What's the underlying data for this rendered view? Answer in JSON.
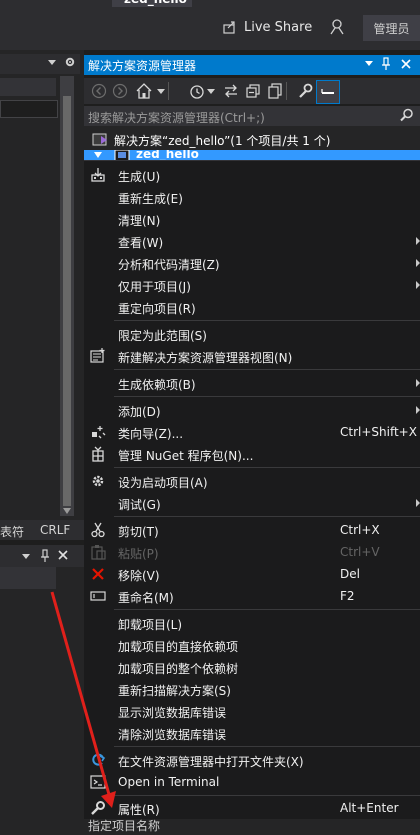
{
  "titlebar": {
    "tab_title": "zed_hello",
    "live_share": "Live Share",
    "admin": "管理员"
  },
  "left_panel": {
    "encoding_label": "表符",
    "line_ending": "CRLF"
  },
  "solution_explorer": {
    "title": "解决方案资源管理器",
    "search_placeholder": "搜索解决方案资源管理器(Ctrl+;)",
    "solution_label": "解决方案“zed_hello”(1 个项目/共 1 个)",
    "project_label": "zed_hello",
    "bottom_text": "指定项目名称"
  },
  "context_menu": {
    "items": [
      {
        "label": "生成(U)",
        "icon": "build-icon"
      },
      {
        "label": "重新生成(E)"
      },
      {
        "label": "清理(N)"
      },
      {
        "label": "查看(W)",
        "submenu": true
      },
      {
        "label": "分析和代码清理(Z)",
        "submenu": true
      },
      {
        "label": "仅用于项目(J)",
        "submenu": true
      },
      {
        "label": "重定向项目(R)"
      },
      {
        "label": "限定为此范围(S)"
      },
      {
        "label": "新建解决方案资源管理器视图(N)",
        "icon": "new-view-icon"
      },
      {
        "label": "生成依赖项(B)",
        "submenu": true
      },
      {
        "label": "添加(D)",
        "submenu": true
      },
      {
        "label": "类向导(Z)...",
        "shortcut": "Ctrl+Shift+X",
        "icon": "class-wizard-icon"
      },
      {
        "label": "管理 NuGet 程序包(N)...",
        "icon": "nuget-icon"
      },
      {
        "label": "设为启动项目(A)",
        "icon": "gear-icon"
      },
      {
        "label": "调试(G)",
        "submenu": true
      },
      {
        "label": "剪切(T)",
        "shortcut": "Ctrl+X",
        "icon": "scissors-icon"
      },
      {
        "label": "粘贴(P)",
        "shortcut": "Ctrl+V",
        "icon": "paste-icon",
        "disabled": true
      },
      {
        "label": "移除(V)",
        "shortcut": "Del",
        "icon": "remove-x-icon"
      },
      {
        "label": "重命名(M)",
        "shortcut": "F2",
        "icon": "rename-icon"
      },
      {
        "label": "卸载项目(L)"
      },
      {
        "label": "加载项目的直接依赖项"
      },
      {
        "label": "加载项目的整个依赖树"
      },
      {
        "label": "重新扫描解决方案(S)"
      },
      {
        "label": "显示浏览数据库错误"
      },
      {
        "label": "清除浏览数据库错误"
      },
      {
        "label": "在文件资源管理器中打开文件夹(X)",
        "icon": "folder-refresh-icon"
      },
      {
        "label": "Open in Terminal",
        "icon": "terminal-icon"
      },
      {
        "label": "属性(R)",
        "shortcut": "Alt+Enter",
        "icon": "wrench-icon"
      }
    ]
  },
  "colors": {
    "accent": "#007acc",
    "selection": "#3399ff",
    "menu_bg": "#1b1b1c",
    "annotation_arrow": "#e0201b"
  }
}
